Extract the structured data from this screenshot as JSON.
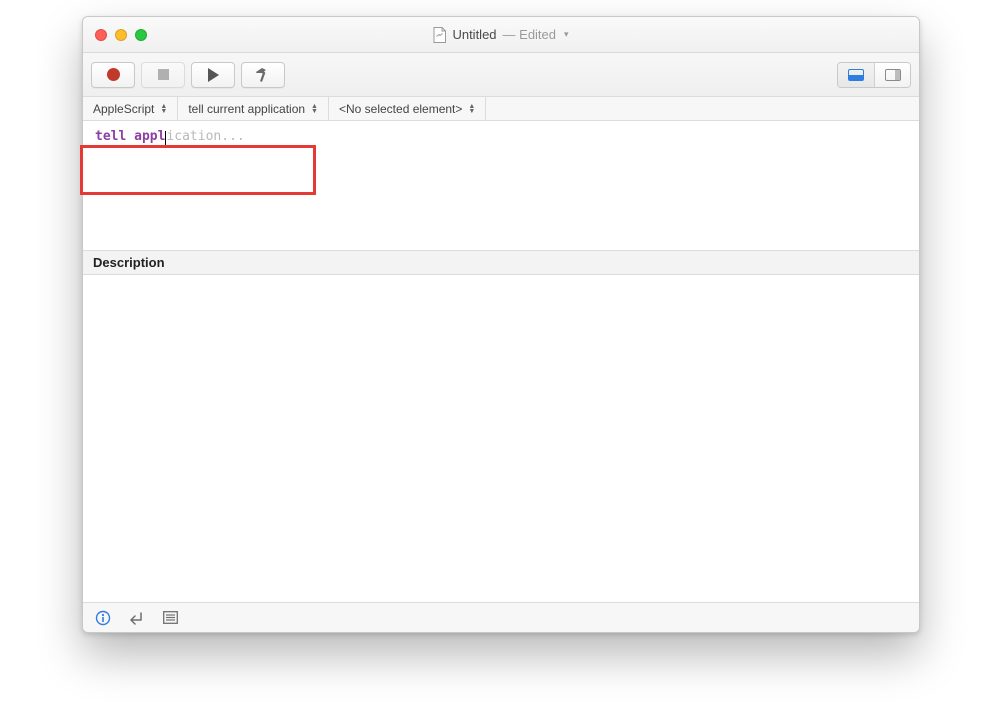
{
  "window": {
    "title": "Untitled",
    "edited_label": "— Edited"
  },
  "navbar": {
    "language": "AppleScript",
    "scope": "tell current application",
    "selection": "<No selected element>"
  },
  "editor": {
    "keyword": "tell",
    "typed": " appl",
    "completion": "ication..."
  },
  "description": {
    "header": "Description"
  }
}
